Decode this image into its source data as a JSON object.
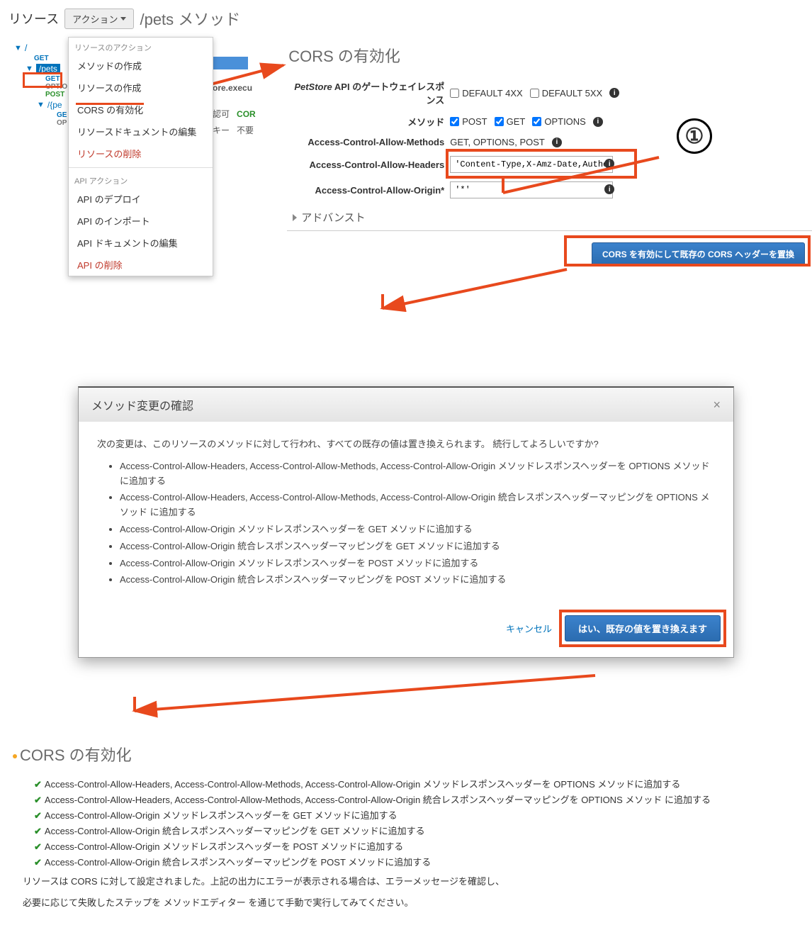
{
  "toolbar": {
    "resource_label": "リソース",
    "action_button": "アクション",
    "path_title": "/pets メソッド"
  },
  "tree": {
    "root": "/",
    "root_get": "GET",
    "pets": "/pets",
    "pets_get": "GET",
    "pets_options": "OPTIO",
    "pets_post": "POST",
    "petid": "/{pe",
    "petid_get": "GE",
    "petid_options": "OP"
  },
  "dropdown": {
    "resource_section": "リソースのアクション",
    "create_method": "メソッドの作成",
    "create_resource": "リソースの作成",
    "enable_cors": "CORS の有効化",
    "edit_resource_doc": "リソースドキュメントの編集",
    "delete_resource": "リソースの削除",
    "api_section": "API アクション",
    "deploy_api": "API のデプロイ",
    "import_api": "API のインポート",
    "edit_api_doc": "API ドキュメントの編集",
    "delete_api": "API の削除"
  },
  "bg_fragments": {
    "ore_exec": "ore.execu",
    "kyoka": "認可",
    "cor": "COR",
    "key": "キー",
    "fuyou": "不要"
  },
  "cors": {
    "title": "CORS の有効化",
    "gateway_label_1": "PetStore",
    "gateway_label_2": " API のゲートウェイレスポンス",
    "default4xx": "DEFAULT 4XX",
    "default5xx": "DEFAULT 5XX",
    "method_label": "メソッド",
    "method_post": "POST",
    "method_get": "GET",
    "method_options": "OPTIONS",
    "allow_methods_label": "Access-Control-Allow-Methods",
    "allow_methods_value": "GET, OPTIONS, POST",
    "allow_headers_label": "Access-Control-Allow-Headers",
    "allow_headers_value": "'Content-Type,X-Amz-Date,Authorizat",
    "allow_origin_label": "Access-Control-Allow-Origin*",
    "allow_origin_value": "'*'",
    "advanced": "アドバンスト",
    "apply_button": "CORS を有効にして既存の CORS ヘッダーを置換"
  },
  "modal": {
    "title": "メソッド変更の確認",
    "lead": "次の変更は、このリソースのメソッドに対して行われ、すべての既存の値は置き換えられます。 続行してよろしいですか?",
    "items": [
      "Access-Control-Allow-Headers, Access-Control-Allow-Methods, Access-Control-Allow-Origin メソッドレスポンスヘッダーを OPTIONS メソッドに追加する",
      "Access-Control-Allow-Headers, Access-Control-Allow-Methods, Access-Control-Allow-Origin 統合レスポンスヘッダーマッピングを OPTIONS メソッド に追加する",
      "Access-Control-Allow-Origin メソッドレスポンスヘッダーを GET メソッドに追加する",
      "Access-Control-Allow-Origin 統合レスポンスヘッダーマッピングを GET メソッドに追加する",
      "Access-Control-Allow-Origin メソッドレスポンスヘッダーを POST メソッドに追加する",
      "Access-Control-Allow-Origin 統合レスポンスヘッダーマッピングを POST メソッドに追加する"
    ],
    "cancel": "キャンセル",
    "confirm": "はい、既存の値を置き換えます"
  },
  "result": {
    "title": "CORS の有効化",
    "items": [
      "Access-Control-Allow-Headers, Access-Control-Allow-Methods, Access-Control-Allow-Origin メソッドレスポンスヘッダーを OPTIONS メソッドに追加する",
      "Access-Control-Allow-Headers, Access-Control-Allow-Methods, Access-Control-Allow-Origin 統合レスポンスヘッダーマッピングを OPTIONS メソッド に追加する",
      "Access-Control-Allow-Origin メソッドレスポンスヘッダーを GET メソッドに追加する",
      "Access-Control-Allow-Origin 統合レスポンスヘッダーマッピングを GET メソッドに追加する",
      "Access-Control-Allow-Origin メソッドレスポンスヘッダーを POST メソッドに追加する",
      "Access-Control-Allow-Origin 統合レスポンスヘッダーマッピングを POST メソッドに追加する"
    ],
    "note1": "リソースは CORS に対して設定されました。上記の出力にエラーが表示される場合は、エラーメッセージを確認し、",
    "note2": "必要に応じて失敗したステップを メソッドエディター を通じて手動で実行してみてください。"
  },
  "annotations": {
    "circle1": "①"
  }
}
